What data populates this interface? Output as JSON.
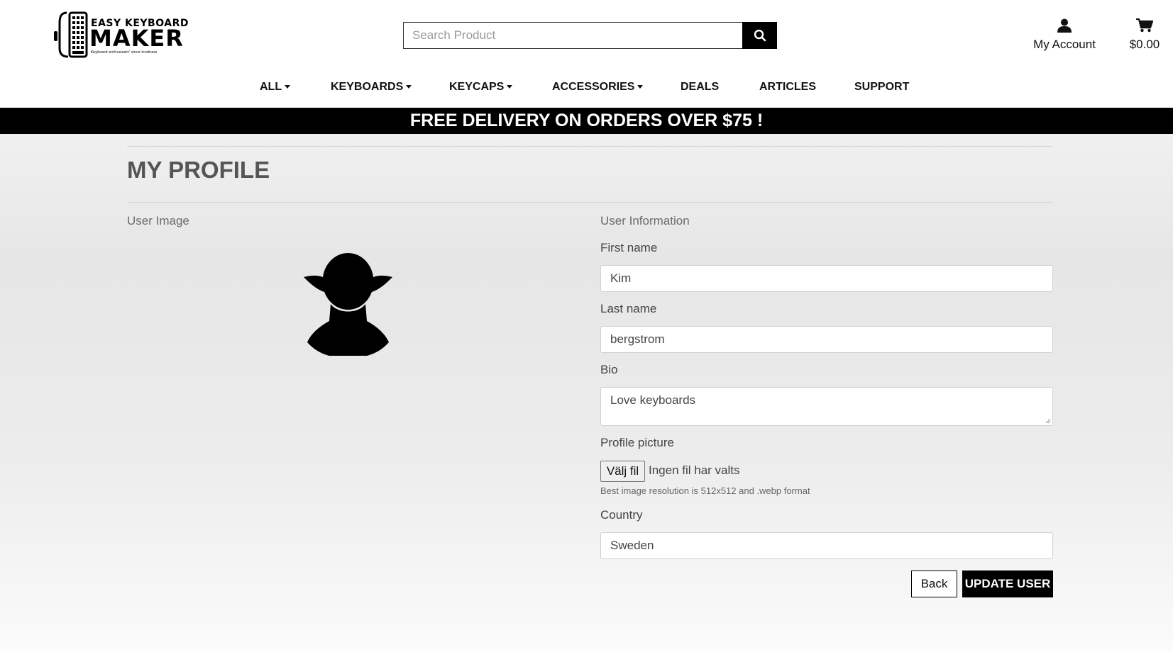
{
  "header": {
    "logo": {
      "line1": "EASY KEYBOARD",
      "line2": "MAKER",
      "tagline": "Keyboard enthusiasts' since kindness"
    },
    "search": {
      "placeholder": "Search Product",
      "icon": "search-icon"
    },
    "account": {
      "label": "My Account",
      "icon": "user-icon"
    },
    "cart": {
      "total": "$0.00",
      "icon": "cart-icon"
    }
  },
  "nav": {
    "items": [
      {
        "label": "ALL",
        "dropdown": true
      },
      {
        "label": "KEYBOARDS",
        "dropdown": true
      },
      {
        "label": "KEYCAPS",
        "dropdown": true
      },
      {
        "label": "ACCESSORIES",
        "dropdown": true
      },
      {
        "label": "DEALS",
        "dropdown": false
      },
      {
        "label": "ARTICLES",
        "dropdown": false
      },
      {
        "label": "SUPPORT",
        "dropdown": false
      }
    ]
  },
  "banner": {
    "text": "FREE DELIVERY ON ORDERS OVER $75 !"
  },
  "profile": {
    "title": "MY PROFILE",
    "user_image_label": "User Image",
    "avatar_icon": "yoda-silhouette-icon",
    "user_info_label": "User Information",
    "fields": {
      "first_name": {
        "label": "First name",
        "value": "Kim"
      },
      "last_name": {
        "label": "Last name",
        "value": "bergstrom"
      },
      "bio": {
        "label": "Bio",
        "value": "Love keyboards"
      },
      "profile_picture": {
        "label": "Profile picture",
        "button": "Välj fil",
        "status": "Ingen fil har valts",
        "hint": "Best image resolution is 512x512 and .webp format"
      },
      "country": {
        "label": "Country",
        "value": "Sweden"
      }
    },
    "buttons": {
      "back": "Back",
      "update": "UPDATE USER"
    }
  },
  "colors": {
    "banner_bg": "#000000",
    "primary_button": "#000000",
    "title": "#555555"
  }
}
